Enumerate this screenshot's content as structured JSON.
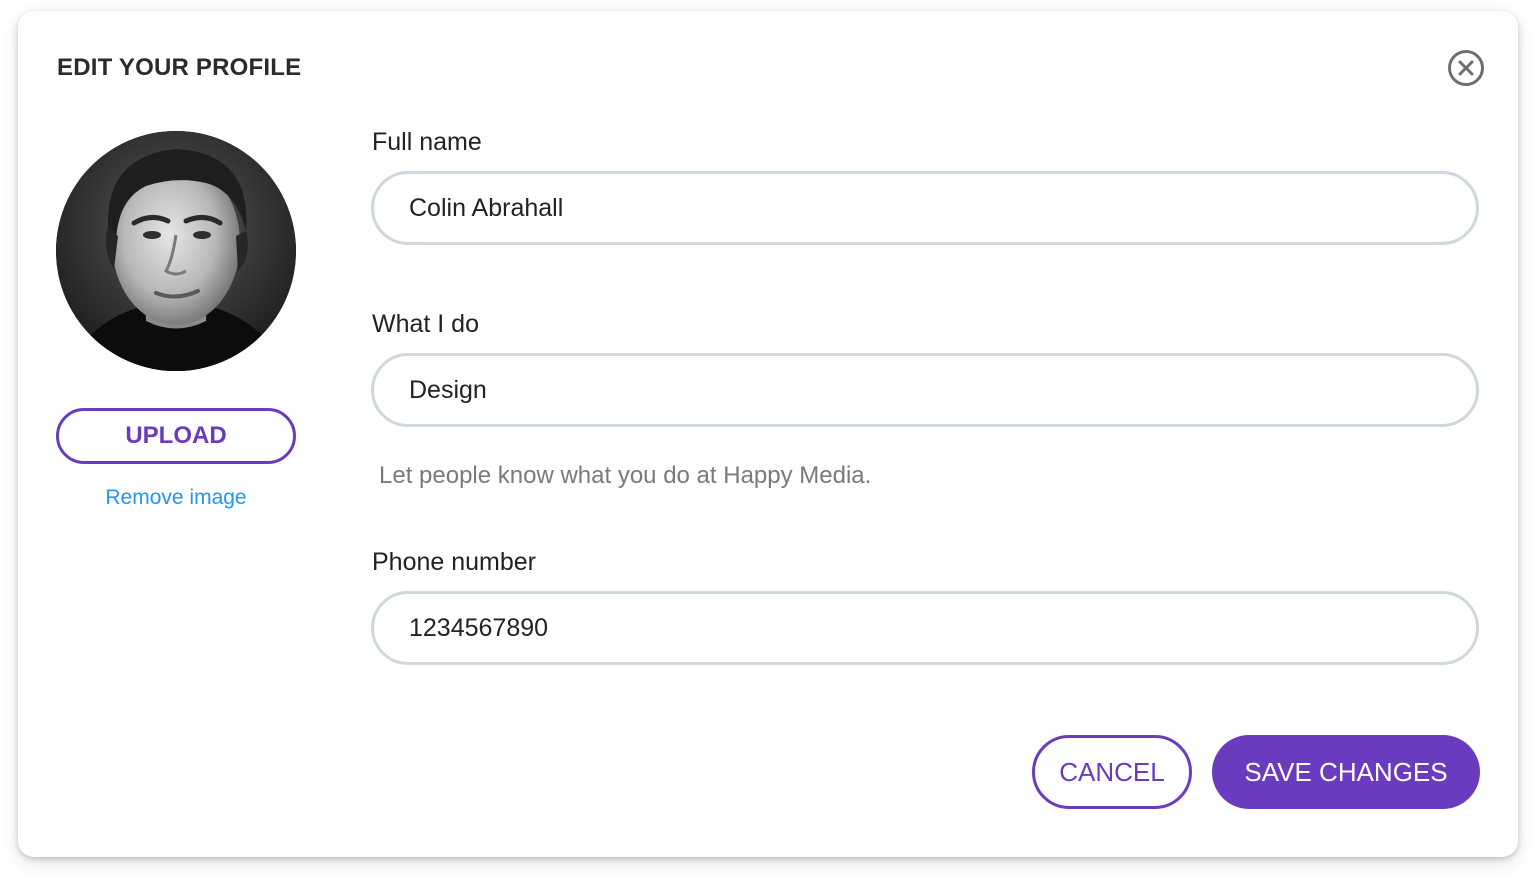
{
  "dialog": {
    "title": "EDIT YOUR PROFILE",
    "close_icon": "close-circle-icon"
  },
  "avatar": {
    "upload_label": "UPLOAD",
    "remove_label": "Remove image"
  },
  "fields": {
    "full_name": {
      "label": "Full name",
      "value": "Colin Abrahall"
    },
    "what_i_do": {
      "label": "What I do",
      "value": "Design",
      "helper": "Let people know what you do at Happy Media."
    },
    "phone": {
      "label": "Phone number",
      "value": "1234567890"
    }
  },
  "actions": {
    "cancel_label": "CANCEL",
    "save_label": "SAVE CHANGES"
  },
  "colors": {
    "accent": "#6a3bbf",
    "link": "#2196f3",
    "input_border": "#cfd8de"
  }
}
